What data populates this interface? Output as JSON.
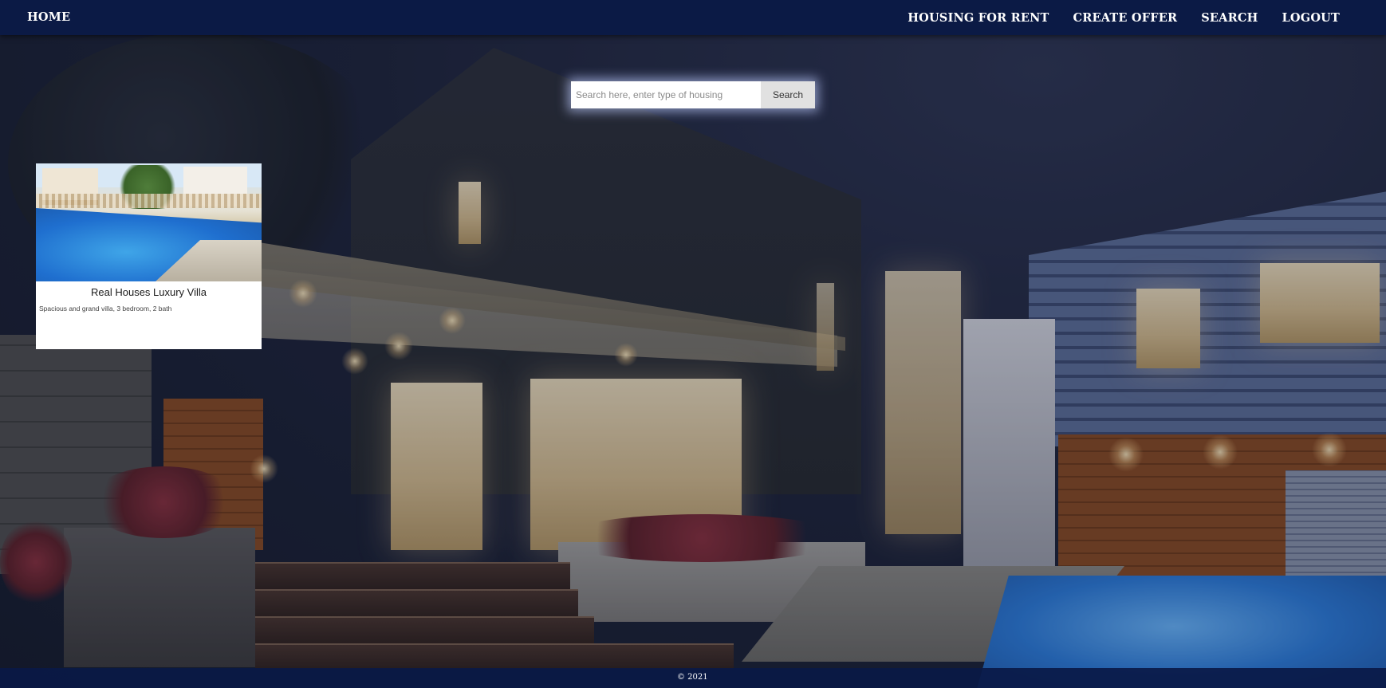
{
  "nav": {
    "home": "HOME",
    "housing_for_rent": "HOUSING FOR RENT",
    "create_offer": "CREATE OFFER",
    "search": "SEARCH",
    "logout": "LOGOUT"
  },
  "search": {
    "placeholder": "Search here, enter type of housing",
    "value": "",
    "button_label": "Search"
  },
  "listing": {
    "title": "Real Houses Luxury Villa",
    "description": "Spacious and grand villa, 3 bedroom, 2 bath"
  },
  "footer": {
    "copyright": "© 2021"
  },
  "colors": {
    "nav_background": "#0b1a45",
    "footer_background": "#0a1946",
    "card_background": "#ffffff",
    "search_button_background": "#e1e1e1"
  }
}
